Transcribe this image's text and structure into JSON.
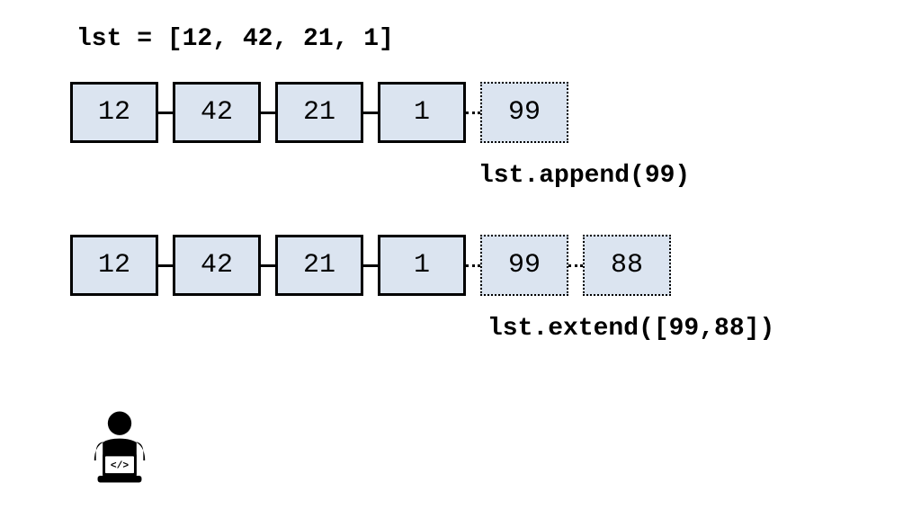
{
  "title_code": "lst = [12, 42, 21, 1]",
  "row1": {
    "cells": [
      "12",
      "42",
      "21",
      "1"
    ],
    "added": [
      "99"
    ],
    "label": "lst.append(99)"
  },
  "row2": {
    "cells": [
      "12",
      "42",
      "21",
      "1"
    ],
    "added": [
      "99",
      "88"
    ],
    "label": "lst.extend([99,88])"
  },
  "colors": {
    "cell_fill": "#dbe4f0",
    "border": "#000000"
  }
}
